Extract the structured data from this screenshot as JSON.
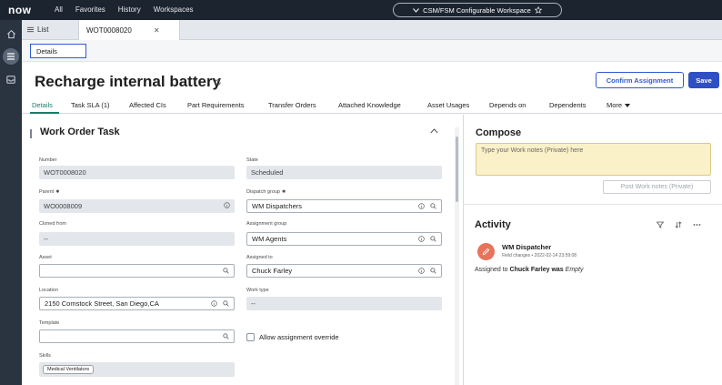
{
  "topnav": {
    "logo": "now",
    "links": [
      "All",
      "Favorites",
      "History",
      "Workspaces"
    ],
    "workspace": "CSM/FSM Configurable Workspace"
  },
  "tabs": {
    "list_label": "List",
    "record_label": "WOT0008020"
  },
  "subbar": {
    "details_label": "Details"
  },
  "header": {
    "title": "Recharge internal battery",
    "confirm_label": "Confirm Assignment",
    "save_label": "Save"
  },
  "record_tabs": [
    "Details",
    "Task SLA (1)",
    "Affected CIs",
    "Part Requirements",
    "Transfer Orders",
    "Attached Knowledge",
    "Asset Usages",
    "Depends on",
    "Dependents",
    "More"
  ],
  "form": {
    "section_title": "Work Order Task",
    "number": {
      "label": "Number",
      "value": "WOT0008020"
    },
    "state": {
      "label": "State",
      "value": "Scheduled"
    },
    "parent": {
      "label": "Parent",
      "value": "WO0008009"
    },
    "dispatch_group": {
      "label": "Dispatch group",
      "value": "WM Dispatchers"
    },
    "cloned_from": {
      "label": "Cloned from",
      "value": "--"
    },
    "assignment_group": {
      "label": "Assignment group",
      "value": "WM Agents"
    },
    "asset": {
      "label": "Asset",
      "value": ""
    },
    "assigned_to": {
      "label": "Assigned to",
      "value": "Chuck Farley"
    },
    "location": {
      "label": "Location",
      "value": "2150 Comstock Street, San Diego,CA"
    },
    "work_type": {
      "label": "Work type",
      "value": "--"
    },
    "template": {
      "label": "Template",
      "value": ""
    },
    "allow_override_label": "Allow assignment override",
    "skills": {
      "label": "Skills",
      "chip": "Medical Ventilators"
    }
  },
  "compose": {
    "title": "Compose",
    "placeholder": "Type your Work notes (Private) here",
    "post_label": "Post Work notes (Private)"
  },
  "activity": {
    "title": "Activity",
    "entry": {
      "author": "WM Dispatcher",
      "meta": "Field changes • 2022-02-14 23:59:08",
      "field": "Assigned to",
      "new_value": "Chuck Farley",
      "was": "was",
      "old_value": "Empty"
    }
  },
  "colors": {
    "nav_bg": "#1c2430",
    "accent_blue": "#2f4fc4",
    "active_tab": "#1a7a6b",
    "compose_bg": "#fbf1c8",
    "avatar": "#e8735a"
  }
}
